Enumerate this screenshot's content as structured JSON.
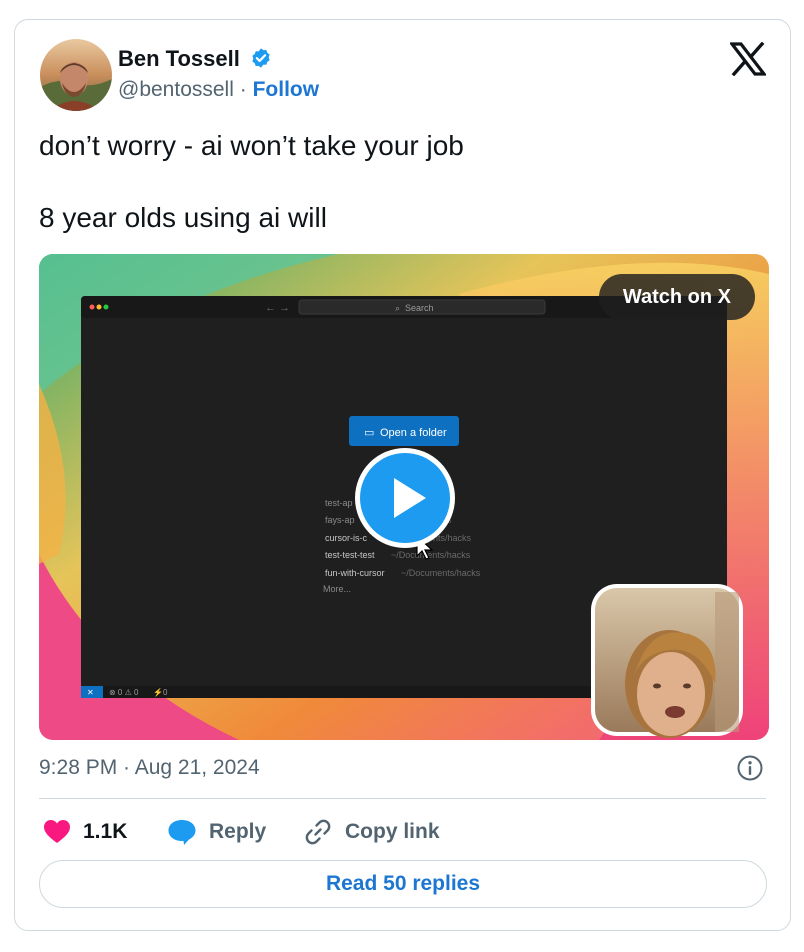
{
  "author": {
    "name": "Ben Tossell",
    "handle": "@bentossell",
    "separator": "·",
    "follow_label": "Follow"
  },
  "tweet": {
    "line1": "don’t worry - ai won’t take your job",
    "line2": "8 year olds using ai will"
  },
  "media": {
    "watch_label": "Watch on X",
    "editor": {
      "search_label": "Search",
      "open_folder_label": "Open a folder",
      "recent": [
        {
          "name": "test-ap",
          "path": ""
        },
        {
          "name": "fays-ap",
          "path": "s"
        },
        {
          "name": "cursor-is-c",
          "path": "nts/hacks"
        },
        {
          "name": "test-test-test",
          "path": "~/Documents/hacks"
        },
        {
          "name": "fun-with-cursor",
          "path": "~/Documents/hacks"
        }
      ],
      "more_label": "More...",
      "status_counts": "⊗ 0 ⚠ 0",
      "status_ports": "0"
    }
  },
  "meta": {
    "timestamp": "9:28 PM · Aug 21, 2024"
  },
  "actions": {
    "likes": "1.1K",
    "reply_label": "Reply",
    "copy_label": "Copy link",
    "read_replies_label": "Read 50 replies"
  },
  "colors": {
    "accent": "#1d77d2",
    "like": "#f91880",
    "verified": "#1d9bf0",
    "muted": "#536471"
  }
}
